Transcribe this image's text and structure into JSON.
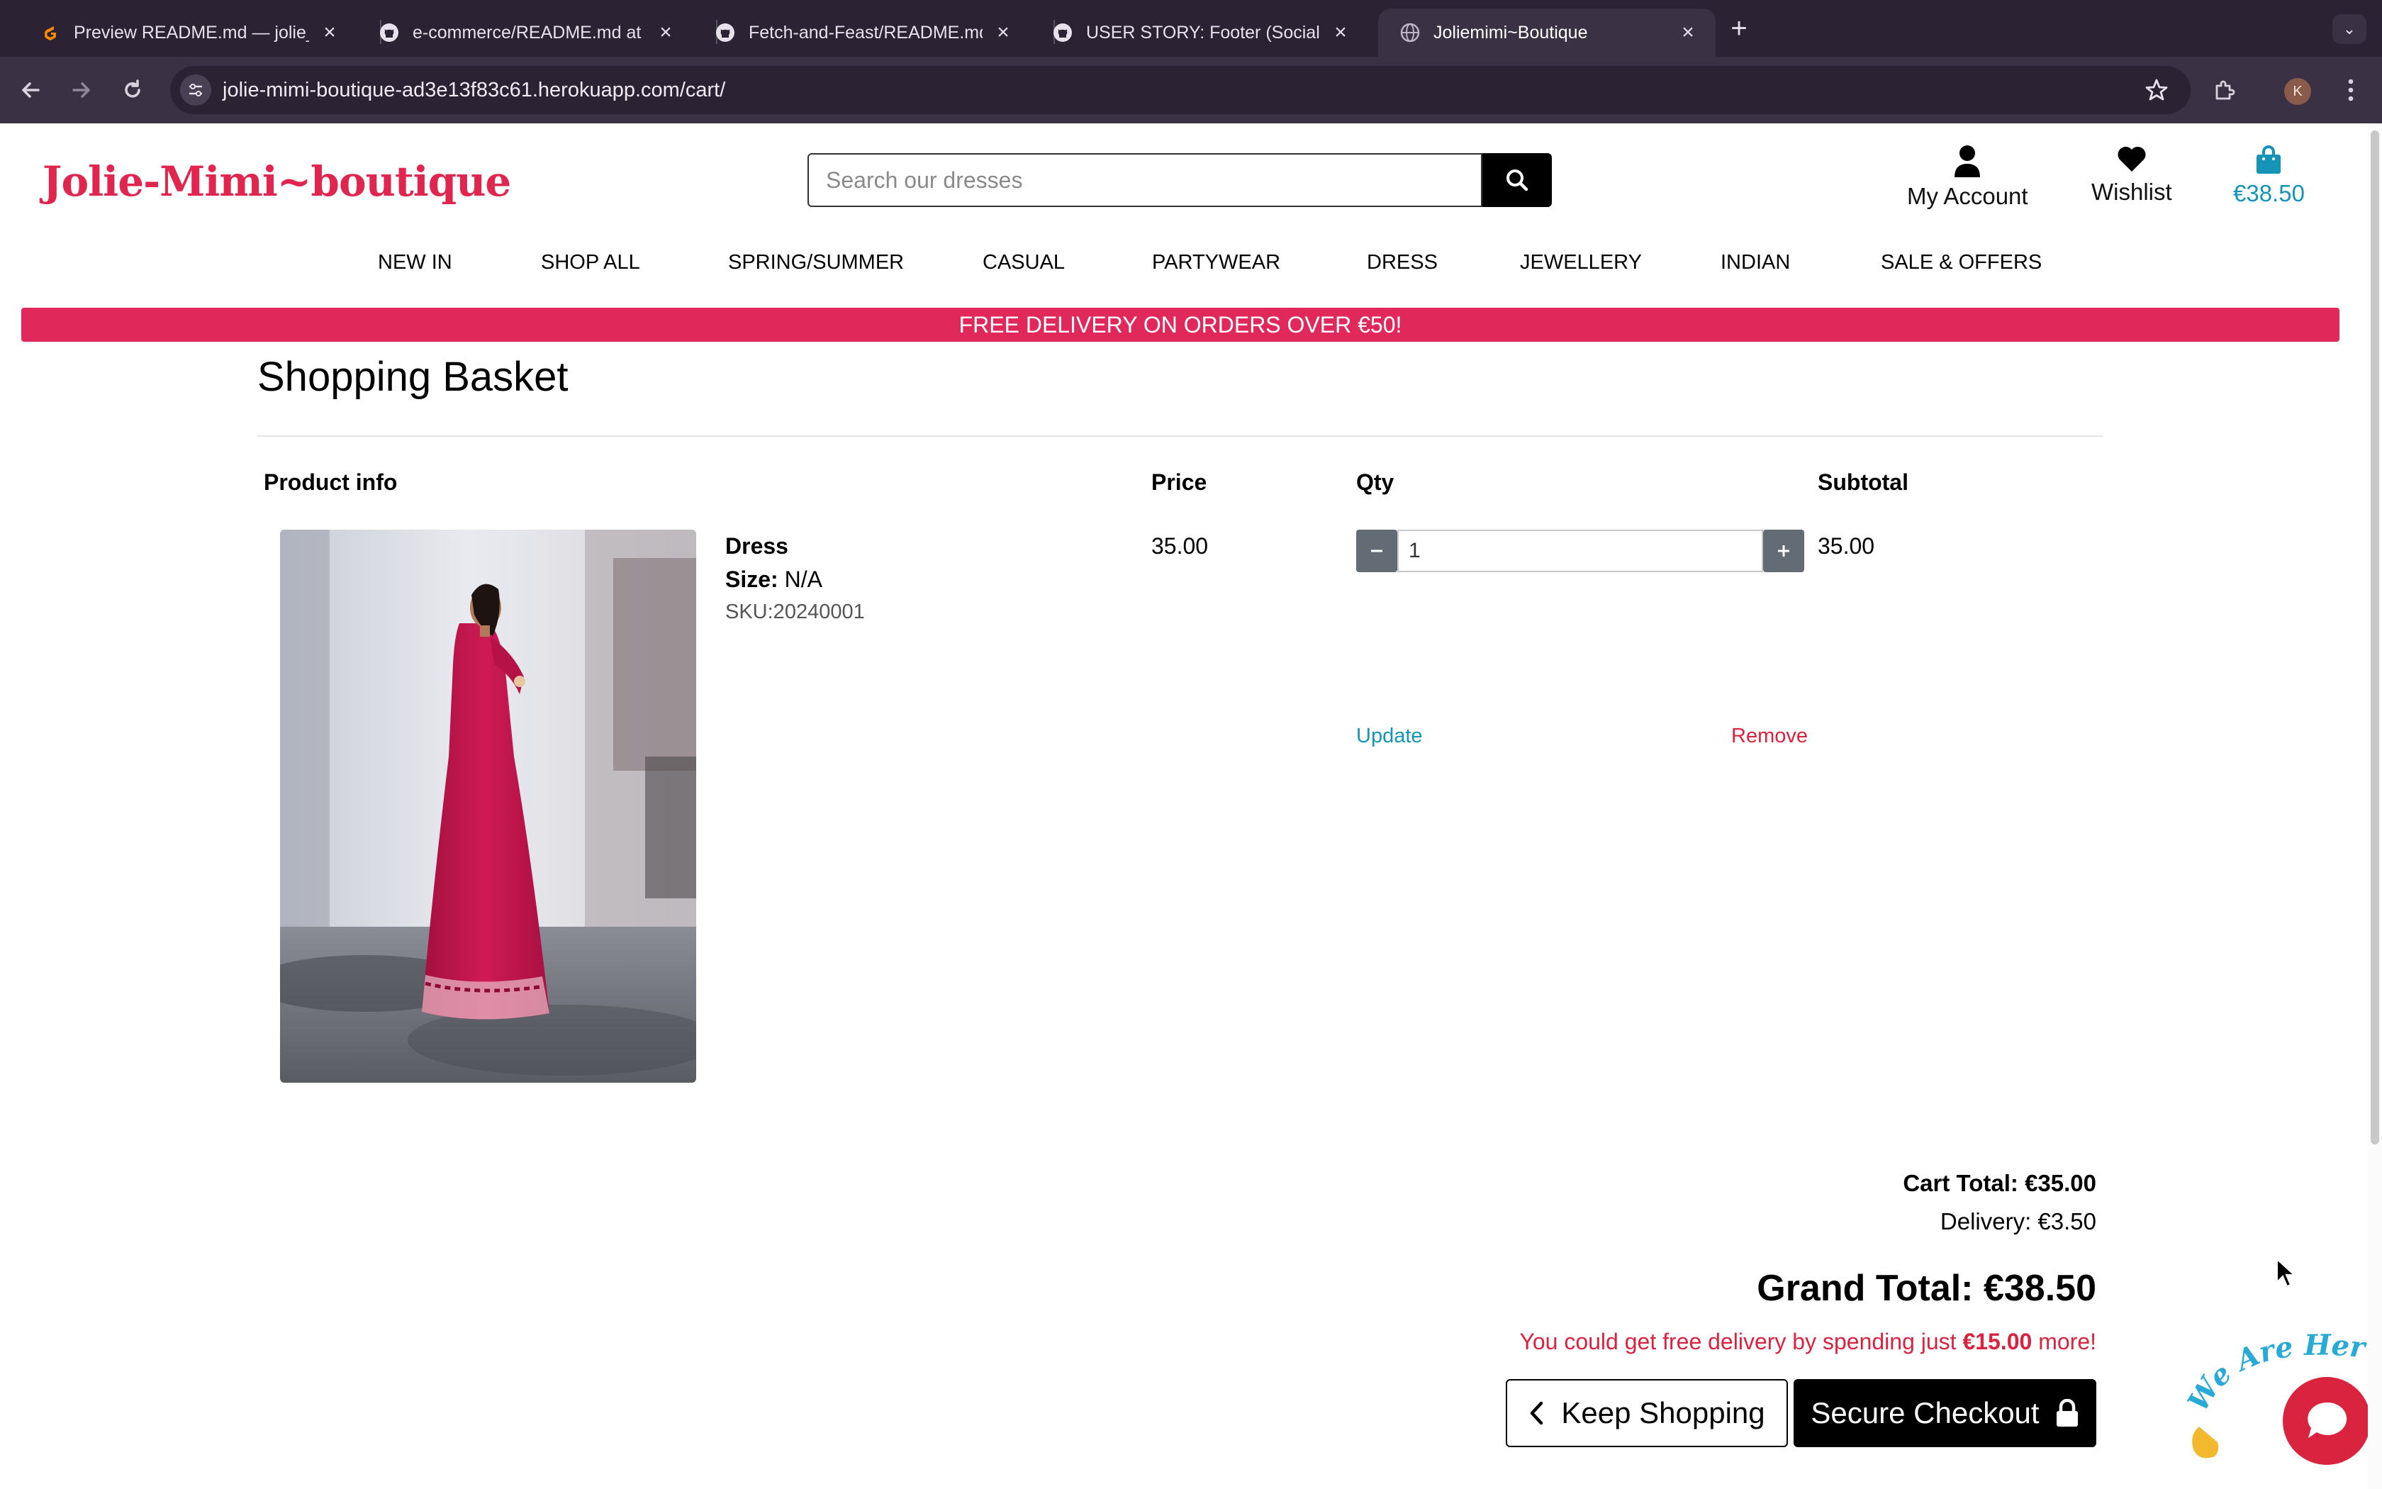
{
  "browser": {
    "tabs": [
      {
        "title": "Preview README.md — jolie_",
        "icon": "gitpod-icon",
        "active": false
      },
      {
        "title": "e-commerce/README.md at m",
        "icon": "github-icon",
        "active": false
      },
      {
        "title": "Fetch-and-Feast/README.md",
        "icon": "github-icon",
        "active": false
      },
      {
        "title": "USER STORY: Footer (Social,",
        "icon": "github-icon",
        "active": false
      },
      {
        "title": "Joliemimi~Boutique",
        "icon": "globe-icon",
        "active": true
      }
    ],
    "url": "jolie-mimi-boutique-ad3e13f83c61.herokuapp.com/cart/",
    "profile_initial": "K"
  },
  "site": {
    "logo": "Jolie-Mimi~boutique",
    "search_placeholder": "Search our dresses",
    "account_label": "My Account",
    "wishlist_label": "Wishlist",
    "basket_total": "€38.50"
  },
  "nav": [
    "NEW IN",
    "SHOP ALL",
    "SPRING/SUMMER",
    "CASUAL",
    "PARTYWEAR",
    "DRESS",
    "JEWELLERY",
    "INDIAN",
    "SALE & OFFERS"
  ],
  "promo_banner": "FREE DELIVERY ON ORDERS OVER €50!",
  "basket": {
    "title": "Shopping Basket",
    "columns": {
      "product": "Product info",
      "price": "Price",
      "qty": "Qty",
      "subtotal": "Subtotal"
    },
    "item": {
      "name": "Dress",
      "size_label": "Size:",
      "size_value": "N/A",
      "sku": "SKU:20240001",
      "price": "35.00",
      "quantity": "1",
      "subtotal": "35.00",
      "update_label": "Update",
      "remove_label": "Remove"
    },
    "cart_total": "Cart Total: €35.00",
    "delivery": "Delivery: €3.50",
    "grand_total": "Grand Total: €38.50",
    "free_delivery_prefix": "You could get free delivery by spending just ",
    "free_delivery_amount": "€15.00",
    "free_delivery_suffix": " more!",
    "keep_shopping_label": "Keep Shopping",
    "checkout_label": "Secure Checkout"
  },
  "chat": {
    "badge_text": "We Are Here!"
  },
  "colors": {
    "brand": "#e0264f",
    "banner": "#e0285b",
    "link": "#1694b8",
    "danger": "#d9233f",
    "dress": "#c4124a"
  }
}
